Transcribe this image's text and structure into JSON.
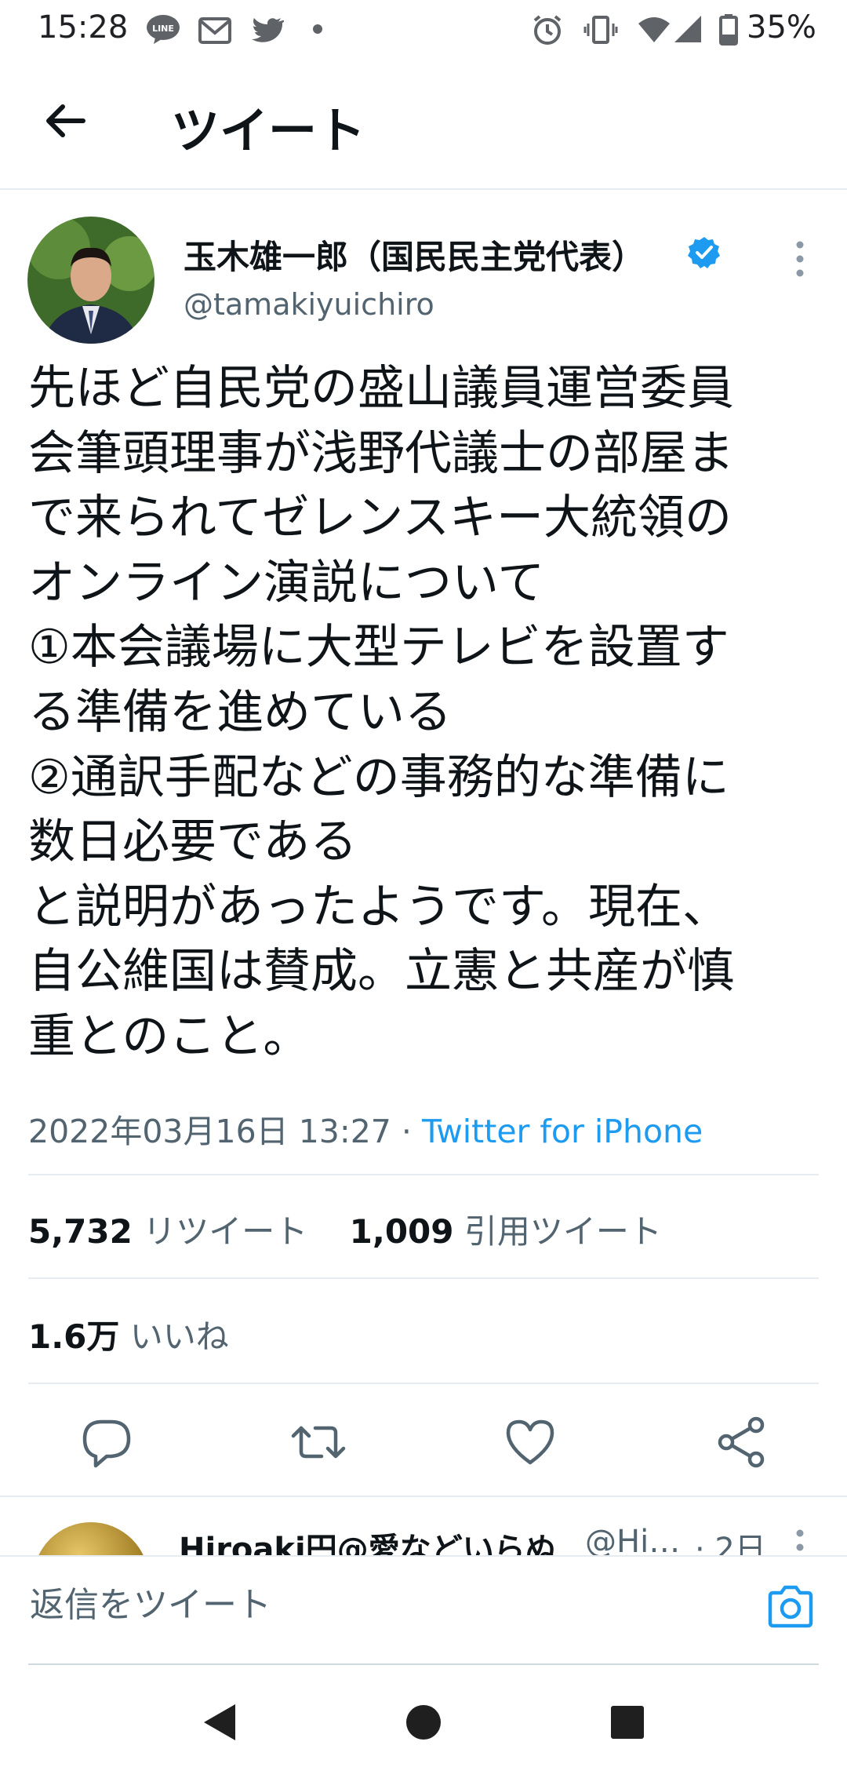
{
  "status_bar": {
    "time": "15:28",
    "battery": "35%",
    "icons": [
      "line-icon",
      "mail-icon",
      "twitter-bird-icon",
      "dot-icon",
      "alarm-icon",
      "vibrate-icon",
      "wifi-icon",
      "signal-icon",
      "battery-icon"
    ]
  },
  "header": {
    "title": "ツイート",
    "back_icon": "back-arrow-icon"
  },
  "tweet": {
    "author_name": "玉木雄一郎（国民民主党代表）",
    "author_handle": "@tamakiyuichiro",
    "verified": true,
    "text": "先ほど自民党の盛山議員運営委員\n会筆頭理事が浅野代議士の部屋ま\nで来られてゼレンスキー大統領の\nオンライン演説について\n①本会議場に大型テレビを設置す\nる準備を進めている\n②通訳手配などの事務的な準備に\n数日必要である\nと説明があったようです。現在、\n自公維国は賛成。立憲と共産が慎\n重とのこと。",
    "datetime": "2022年03月16日 13:27",
    "separator": " · ",
    "source": "Twitter for iPhone"
  },
  "stats": {
    "retweets": "5,732",
    "retweets_label": "リツイート",
    "quotes": "1,009",
    "quotes_label": "引用ツイート",
    "likes": "1.6万",
    "likes_label": "いいね"
  },
  "actions": [
    "reply-icon",
    "retweet-icon",
    "like-icon",
    "share-icon"
  ],
  "reply_preview": {
    "name": "Hiroaki円@愛などいらぬ",
    "handle": "@Hi…",
    "time": "· 2日"
  },
  "composer": {
    "placeholder": "返信をツイート"
  },
  "colors": {
    "accent": "#1d9bf0",
    "secondary_text": "#536471",
    "primary_text": "#0f1419"
  }
}
